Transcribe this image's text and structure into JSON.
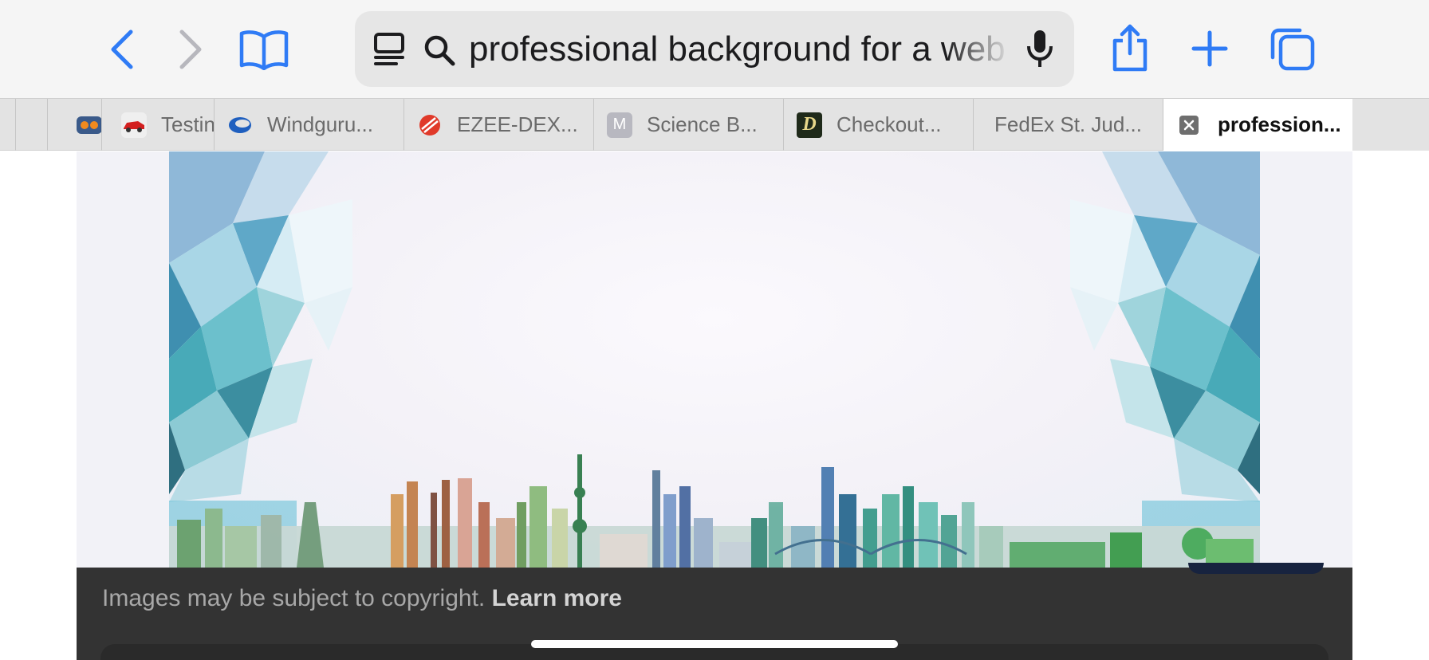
{
  "toolbar": {
    "back_icon": "chevron-left-icon",
    "forward_icon": "chevron-right-icon",
    "bookmarks_icon": "book-icon",
    "search_text": "professional background for a web",
    "share_icon": "share-icon",
    "new_tab_icon": "plus-icon",
    "tabs_overview_icon": "tabs-overview-icon",
    "accent_color": "#2f7bf5",
    "disabled_color": "#b7b7bd"
  },
  "tabs": [
    {
      "label": "",
      "favicon": "blank"
    },
    {
      "label": "",
      "favicon": "orange-dots-icon"
    },
    {
      "label": "Testin",
      "favicon": "red-car-icon"
    },
    {
      "label": "Windguru...",
      "favicon": "blue-swirl-icon"
    },
    {
      "label": "EZEE-DEX...",
      "favicon": "red-stripes-icon"
    },
    {
      "label": "Science B...",
      "favicon": "M"
    },
    {
      "label": "Checkout...",
      "favicon": "D"
    },
    {
      "label": "FedEx St. Jud...",
      "favicon": ""
    },
    {
      "label": "profession...",
      "favicon": "close-icon",
      "active": true
    }
  ],
  "content": {
    "image_subject": "city-skyline-polygon-background"
  },
  "sheet": {
    "copyright_text": "Images may be subject to copyright.",
    "learn_more": "Learn more"
  }
}
